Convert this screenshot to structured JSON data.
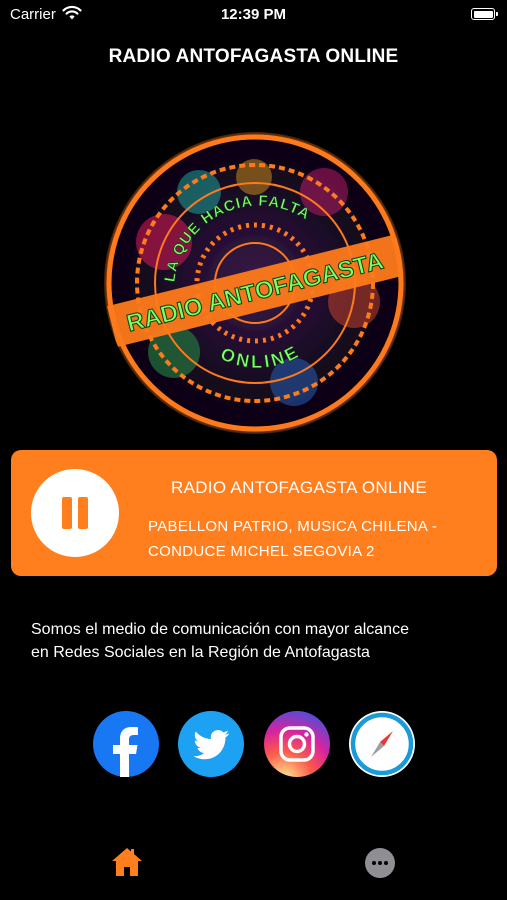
{
  "status_bar": {
    "carrier": "Carrier",
    "time": "12:39 PM",
    "battery_level": 1.0
  },
  "header": {
    "title": "RADIO ANTOFAGASTA ONLINE"
  },
  "logo": {
    "top_text": "LA QUE HACIA FALTA",
    "banner_text": "RADIO ANTOFAGASTA",
    "bottom_text": "ONLINE",
    "ring_color": "#ff7a1a",
    "text_color": "#7dff6a"
  },
  "player": {
    "station_name": "RADIO ANTOFAGASTA ONLINE",
    "now_playing_line1": "PABELLON PATRIO, MUSICA CHILENA -",
    "now_playing_line2": "CONDUCE MICHEL SEGOVIA 2",
    "state": "playing",
    "control_icon": "pause-icon",
    "card_color": "#ff7f1e"
  },
  "description": {
    "line1": "Somos el medio de comunicación con mayor alcance",
    "line2": "en Redes Sociales en la Región de Antofagasta"
  },
  "social": [
    {
      "icon": "facebook-icon",
      "color": "#1877f2"
    },
    {
      "icon": "twitter-icon",
      "color": "#1da1f2"
    },
    {
      "icon": "instagram-icon",
      "color": "#d6249f"
    },
    {
      "icon": "compass-icon",
      "color": "#1a9ad6"
    }
  ],
  "tabbar": {
    "items": [
      {
        "icon": "home-icon",
        "active": true,
        "color": "#ff7f1e"
      },
      {
        "icon": "more-icon",
        "active": false,
        "color": "#8e8e93"
      }
    ]
  }
}
